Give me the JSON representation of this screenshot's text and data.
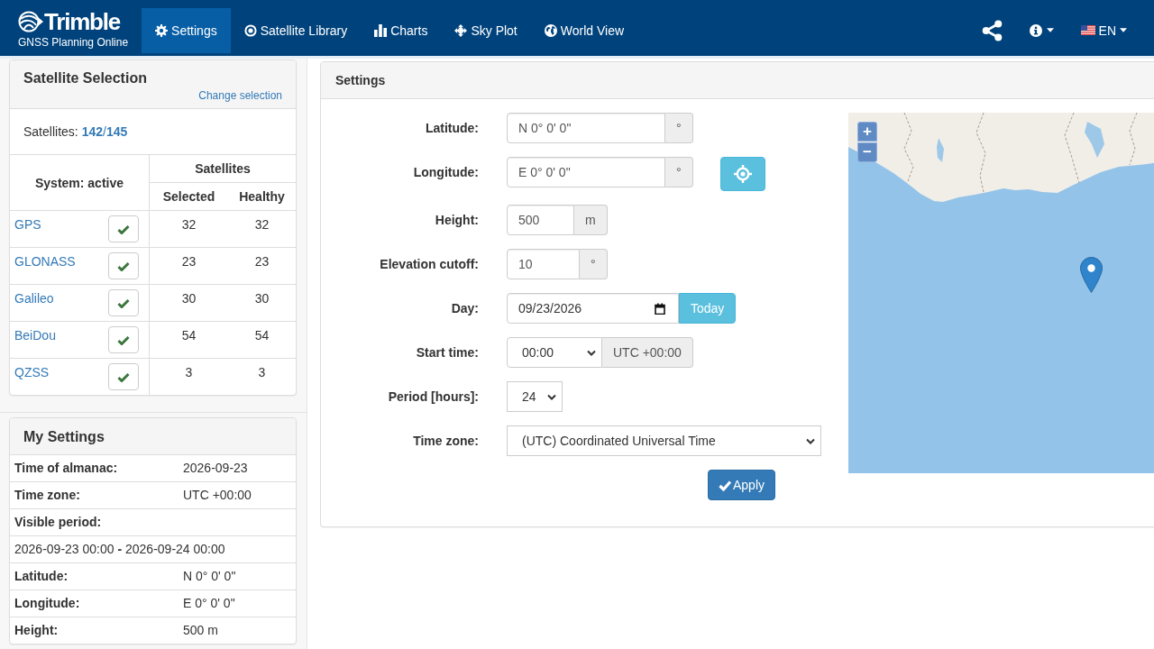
{
  "navbar": {
    "brand": "Trimble",
    "subtitle": "GNSS Planning Online",
    "items": [
      {
        "label": "Settings",
        "selected": true
      },
      {
        "label": "Satellite Library",
        "selected": false
      },
      {
        "label": "Charts",
        "selected": false
      },
      {
        "label": "Sky Plot",
        "selected": false
      },
      {
        "label": "World View",
        "selected": false
      }
    ],
    "language": "EN"
  },
  "satellite_selection": {
    "title": "Satellite Selection",
    "change_link": "Change selection",
    "satellites_label": "Satellites:",
    "satellites_count": "**142**/**145**",
    "columns": {
      "system": "System: active",
      "satellites": "Satellites",
      "selected": "Selected",
      "healthy": "Healthy"
    },
    "rows": [
      {
        "name": "GPS",
        "checked": true,
        "selected": "32",
        "healthy": "32"
      },
      {
        "name": "GLONASS",
        "checked": true,
        "selected": "23",
        "healthy": "23"
      },
      {
        "name": "Galileo",
        "checked": true,
        "selected": "30",
        "healthy": "30"
      },
      {
        "name": "BeiDou",
        "checked": true,
        "selected": "54",
        "healthy": "54"
      },
      {
        "name": "QZSS",
        "checked": true,
        "selected": "3",
        "healthy": "3"
      }
    ]
  },
  "my_settings": {
    "title": "My Settings",
    "rows": [
      {
        "kind": "pair",
        "label": "Time of almanac:",
        "value": "2026-09-23"
      },
      {
        "kind": "pair",
        "label": "Time zone:",
        "value": "UTC +00:00"
      },
      {
        "kind": "heading",
        "label": "Visible period:"
      },
      {
        "kind": "text",
        "text": "2026-09-23 00:00 **-** 2026-09-24 00:00"
      },
      {
        "kind": "pair",
        "label": "Latitude:",
        "value": "N 0° 0' 0\""
      },
      {
        "kind": "pair",
        "label": "Longitude:",
        "value": "E 0° 0' 0\""
      },
      {
        "kind": "pair",
        "label": "Height:",
        "value": "500 m"
      }
    ]
  },
  "settings": {
    "title": "Settings",
    "fields": [
      {
        "kind": "input",
        "label": "Latitude:",
        "value": "N 0° 0' 0\"",
        "addon": "°"
      },
      {
        "kind": "locate",
        "label": "Longitude:",
        "value": "E 0° 0' 0\"",
        "addon": "°"
      },
      {
        "kind": "input",
        "label": "Height:",
        "value": "500",
        "addon": "m"
      },
      {
        "kind": "input",
        "label": "Elevation cutoff:",
        "value": "10",
        "addon": "°"
      },
      {
        "kind": "date",
        "label": "Day:",
        "value": "09/23/2026",
        "button": "Today"
      },
      {
        "kind": "time",
        "label": "Start time:",
        "value": "00:00",
        "addon": "UTC +00:00"
      },
      {
        "kind": "select",
        "label": "Period [hours]:",
        "value": "24"
      },
      {
        "kind": "select",
        "label": "Time zone:",
        "value": "(UTC) Coordinated Universal Time"
      }
    ],
    "apply": "Apply"
  },
  "map": {
    "zoom_in": "+",
    "zoom_out": "−"
  }
}
